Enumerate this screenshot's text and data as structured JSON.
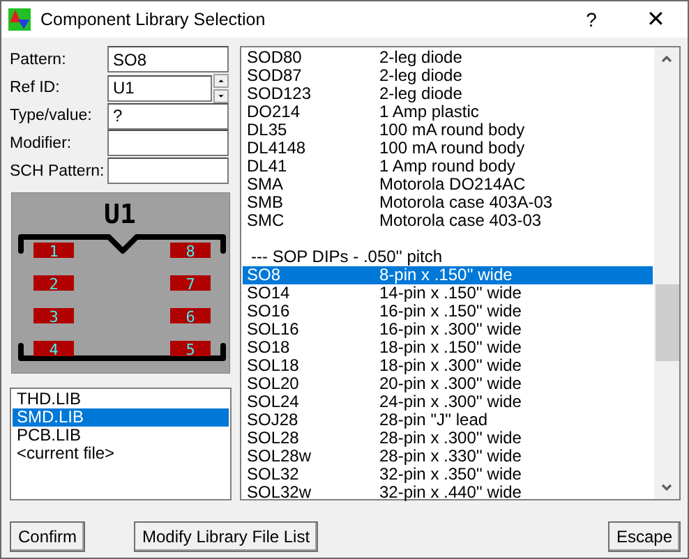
{
  "window": {
    "title": "Component Library Selection",
    "help": "?",
    "close": "✕"
  },
  "fields": [
    {
      "label": "Pattern:",
      "value": "SO8",
      "kind": "text"
    },
    {
      "label": "Ref ID:",
      "value": "U1",
      "kind": "spin"
    },
    {
      "label": "Type/value:",
      "value": "?",
      "kind": "text"
    },
    {
      "label": "Modifier:",
      "kind": "text"
    },
    {
      "label": "SCH Pattern:",
      "kind": "text"
    }
  ],
  "preview": {
    "ref": "U1",
    "pin_rows": [
      [
        "1",
        "8"
      ],
      [
        "2",
        "7"
      ],
      [
        "3",
        "6"
      ],
      [
        "4",
        "5"
      ]
    ]
  },
  "libraries": [
    {
      "name": "THD.LIB",
      "selected": false
    },
    {
      "name": "SMD.LIB",
      "selected": true
    },
    {
      "name": "PCB.LIB",
      "selected": false
    },
    {
      "name": "<current file>",
      "selected": false
    }
  ],
  "patterns": [
    {
      "kind": "item",
      "name": "SOD80",
      "desc": "2-leg diode",
      "selected": false
    },
    {
      "kind": "item",
      "name": "SOD87",
      "desc": "2-leg diode",
      "selected": false
    },
    {
      "kind": "item",
      "name": "SOD123",
      "desc": "2-leg diode",
      "selected": false
    },
    {
      "kind": "item",
      "name": "DO214",
      "desc": "1 Amp plastic",
      "selected": false
    },
    {
      "kind": "item",
      "name": "DL35",
      "desc": "100 mA round body",
      "selected": false
    },
    {
      "kind": "item",
      "name": "DL4148",
      "desc": "100 mA round body",
      "selected": false
    },
    {
      "kind": "item",
      "name": "DL41",
      "desc": "1 Amp round body",
      "selected": false
    },
    {
      "kind": "item",
      "name": "SMA",
      "desc": "Motorola DO214AC",
      "selected": false
    },
    {
      "kind": "item",
      "name": "SMB",
      "desc": "Motorola case 403A-03",
      "selected": false
    },
    {
      "kind": "item",
      "name": "SMC",
      "desc": "Motorola case 403-03",
      "selected": false
    },
    {
      "kind": "blank"
    },
    {
      "kind": "header",
      "text": "--- SOP DIPs - .050'' pitch"
    },
    {
      "kind": "item",
      "name": "SO8",
      "desc": "8-pin x .150'' wide",
      "selected": true
    },
    {
      "kind": "item",
      "name": "SO14",
      "desc": "14-pin x .150'' wide",
      "selected": false
    },
    {
      "kind": "item",
      "name": "SO16",
      "desc": "16-pin x .150'' wide",
      "selected": false
    },
    {
      "kind": "item",
      "name": "SOL16",
      "desc": "16-pin x .300'' wide",
      "selected": false
    },
    {
      "kind": "item",
      "name": "SO18",
      "desc": "18-pin x .150'' wide",
      "selected": false
    },
    {
      "kind": "item",
      "name": "SOL18",
      "desc": "18-pin x .300'' wide",
      "selected": false
    },
    {
      "kind": "item",
      "name": "SOL20",
      "desc": "20-pin x .300'' wide",
      "selected": false
    },
    {
      "kind": "item",
      "name": "SOL24",
      "desc": "24-pin x .300'' wide",
      "selected": false
    },
    {
      "kind": "item",
      "name": "SOJ28",
      "desc": "28-pin \"J'' lead",
      "selected": false
    },
    {
      "kind": "item",
      "name": "SOL28",
      "desc": "28-pin x .300'' wide",
      "selected": false
    },
    {
      "kind": "item",
      "name": "SOL28w",
      "desc": "28-pin x .330'' wide",
      "selected": false
    },
    {
      "kind": "item",
      "name": "SOL32",
      "desc": "32-pin x .350'' wide",
      "selected": false
    },
    {
      "kind": "item",
      "name": "SOL32w",
      "desc": "32-pin x .440'' wide",
      "selected": false
    }
  ],
  "buttons": [
    {
      "label": "Confirm"
    },
    {
      "label": "Modify Library File List"
    },
    {
      "label": "Escape"
    }
  ]
}
